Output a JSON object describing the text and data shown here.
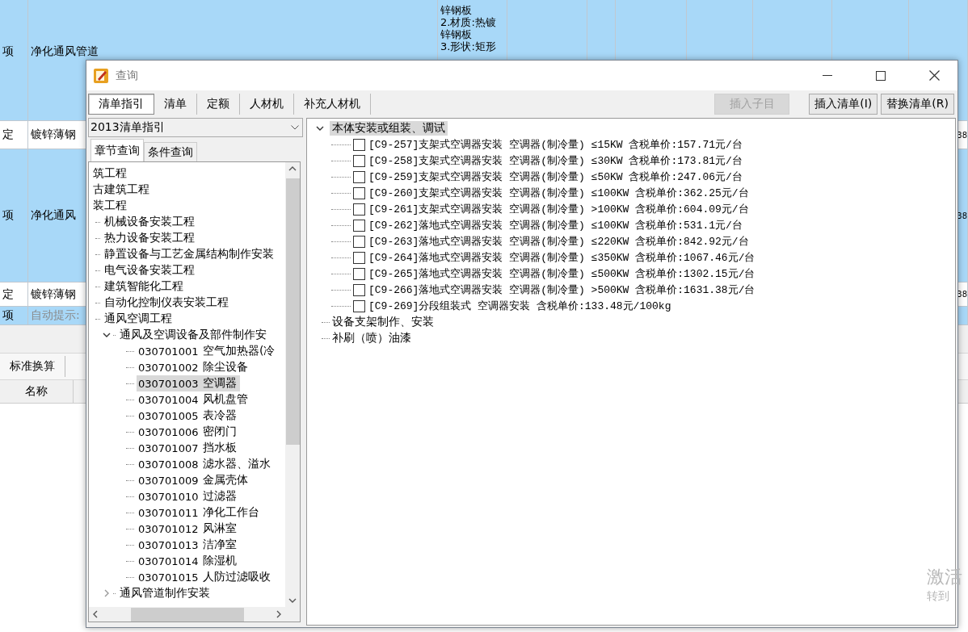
{
  "background_table": {
    "rows": [
      {
        "type": "项",
        "name": "净化通风管道",
        "description": [
          "锌钢板",
          "2.材质:热镀",
          "锌钢板",
          "3.形状:矩形"
        ],
        "selected": true,
        "kind": "normal"
      },
      {
        "type": "定",
        "name": "镀锌薄钢",
        "selected": false,
        "kind": "normal",
        "column_10": "38"
      },
      {
        "type": "项",
        "name": "净化通风",
        "selected": true,
        "kind": "normal",
        "column_10": "38"
      },
      {
        "type": "定",
        "name": "镀锌薄钢",
        "selected": false,
        "kind": "normal",
        "column_10": "38"
      },
      {
        "type": "项",
        "name": "自动提示:",
        "selected": true,
        "kind": "hint"
      }
    ]
  },
  "bottom_panel": {
    "buttons": [
      "标准换算"
    ],
    "columns": [
      "名称"
    ]
  },
  "system_notice": [
    "激活",
    "转到"
  ],
  "dialog": {
    "title": "查询",
    "tabs": [
      {
        "label": "清单指引",
        "selected": true
      },
      {
        "label": "清单",
        "selected": false
      },
      {
        "label": "定额",
        "selected": false
      },
      {
        "label": "人材机",
        "selected": false
      },
      {
        "label": "补充人材机",
        "selected": false
      }
    ],
    "buttons": [
      {
        "label": "插入子目",
        "disabled": true
      },
      {
        "label": "插入清单(I)",
        "disabled": false
      },
      {
        "label": "替换清单(R)",
        "disabled": false
      }
    ],
    "left_panel": {
      "dropdown": "2013清单指引",
      "tabs": [
        {
          "label": "章节查询",
          "selected": true
        },
        {
          "label": "条件查询",
          "selected": false
        }
      ],
      "tree": [
        {
          "label": "筑工程",
          "selected": false
        },
        {
          "label": "古建筑工程",
          "selected": false
        },
        {
          "label": "装工程",
          "selected": false,
          "children": [
            {
              "label": "机械设备安装工程",
              "selected": false
            },
            {
              "label": "热力设备安装工程",
              "selected": false
            },
            {
              "label": "静置设备与工艺金属结构制作安装",
              "selected": false
            },
            {
              "label": "电气设备安装工程",
              "selected": false
            },
            {
              "label": "建筑智能化工程",
              "selected": false
            },
            {
              "label": "自动化控制仪表安装工程",
              "selected": false
            },
            {
              "label": "通风空调工程",
              "selected": false,
              "children": [
                {
                  "label": "通风及空调设备及部件制作安",
                  "selected": false,
                  "expanded": true,
                  "children": [
                    {
                      "code": "030701001",
                      "label": "空气加热器(冷",
                      "selected": false
                    },
                    {
                      "code": "030701002",
                      "label": "除尘设备",
                      "selected": false
                    },
                    {
                      "code": "030701003",
                      "label": "空调器",
                      "selected": true
                    },
                    {
                      "code": "030701004",
                      "label": "风机盘管",
                      "selected": false
                    },
                    {
                      "code": "030701005",
                      "label": "表冷器",
                      "selected": false
                    },
                    {
                      "code": "030701006",
                      "label": "密闭门",
                      "selected": false
                    },
                    {
                      "code": "030701007",
                      "label": "挡水板",
                      "selected": false
                    },
                    {
                      "code": "030701008",
                      "label": "滤水器、溢水",
                      "selected": false
                    },
                    {
                      "code": "030701009",
                      "label": "金属壳体",
                      "selected": false
                    },
                    {
                      "code": "030701010",
                      "label": "过滤器",
                      "selected": false
                    },
                    {
                      "code": "030701011",
                      "label": "净化工作台",
                      "selected": false
                    },
                    {
                      "code": "030701012",
                      "label": "风淋室",
                      "selected": false
                    },
                    {
                      "code": "030701013",
                      "label": "洁净室",
                      "selected": false
                    },
                    {
                      "code": "030701014",
                      "label": "除湿机",
                      "selected": false
                    },
                    {
                      "code": "030701015",
                      "label": "人防过滤吸收",
                      "selected": false
                    }
                  ]
                },
                {
                  "label": "通风管道制作安装",
                  "selected": false,
                  "expanded": false
                }
              ]
            }
          ]
        }
      ]
    },
    "right_panel": {
      "tree": [
        {
          "label": "本体安装或组装、调试",
          "selected": true,
          "expanded": true,
          "children": [
            {
              "label": "[C9-257]支架式空调器安装 空调器(制冷量) ≤15KW 含税单价:157.71元/台",
              "checked": false
            },
            {
              "label": "[C9-258]支架式空调器安装 空调器(制冷量) ≤30KW 含税单价:173.81元/台",
              "checked": false
            },
            {
              "label": "[C9-259]支架式空调器安装 空调器(制冷量) ≤50KW 含税单价:247.06元/台",
              "checked": false
            },
            {
              "label": "[C9-260]支架式空调器安装 空调器(制冷量) ≤100KW 含税单价:362.25元/台",
              "checked": false
            },
            {
              "label": "[C9-261]支架式空调器安装 空调器(制冷量) >100KW 含税单价:604.09元/台",
              "checked": false
            },
            {
              "label": "[C9-262]落地式空调器安装 空调器(制冷量) ≤100KW 含税单价:531.1元/台",
              "checked": false
            },
            {
              "label": "[C9-263]落地式空调器安装 空调器(制冷量) ≤220KW 含税单价:842.92元/台",
              "checked": false
            },
            {
              "label": "[C9-264]落地式空调器安装 空调器(制冷量) ≤350KW 含税单价:1067.46元/台",
              "checked": false
            },
            {
              "label": "[C9-265]落地式空调器安装 空调器(制冷量) ≤500KW 含税单价:1302.15元/台",
              "checked": false
            },
            {
              "label": "[C9-266]落地式空调器安装 空调器(制冷量) >500KW 含税单价:1631.38元/台",
              "checked": false
            },
            {
              "label": "[C9-269]分段组装式 空调器安装 含税单价:133.48元/100kg",
              "checked": false
            }
          ]
        },
        {
          "label": "设备支架制作、安装",
          "selected": false
        },
        {
          "label": "补刷（喷）油漆",
          "selected": false
        }
      ]
    }
  }
}
